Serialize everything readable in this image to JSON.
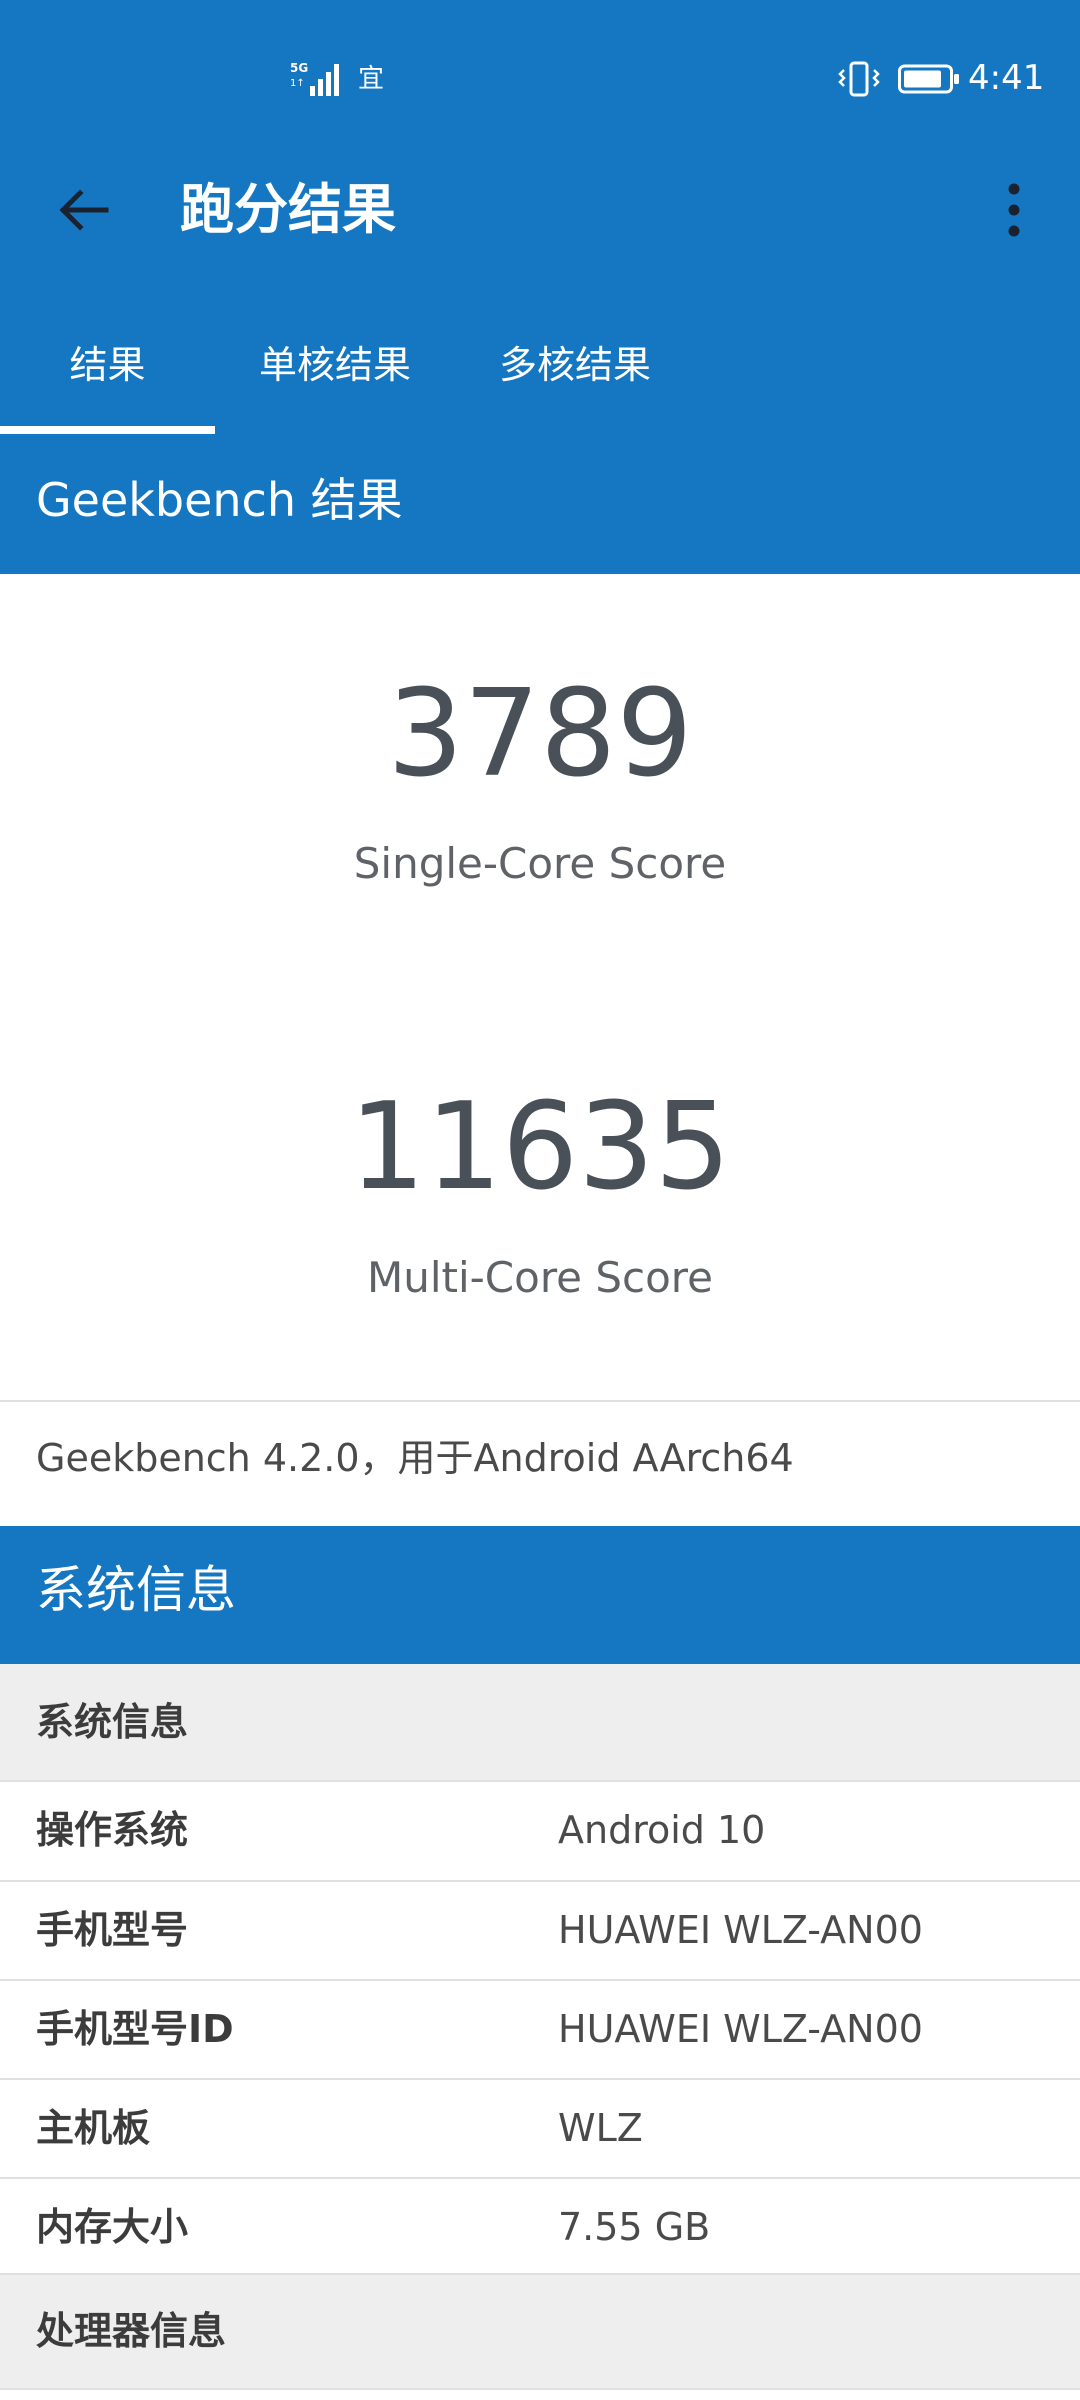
{
  "status_bar": {
    "network_tag": "5G",
    "network_sub": "1↑",
    "extra_icon_text": "宜",
    "time": "4:41"
  },
  "app_bar": {
    "title": "跑分结果",
    "back_icon": "arrow-left-icon",
    "menu_icon": "more-vert-icon"
  },
  "tabs": [
    {
      "label": "结果",
      "selected": true
    },
    {
      "label": "单核结果",
      "selected": false
    },
    {
      "label": "多核结果",
      "selected": false
    }
  ],
  "results": {
    "header": "Geekbench 结果",
    "single_core_score": "3789",
    "single_core_label": "Single-Core Score",
    "multi_core_score": "11635",
    "multi_core_label": "Multi-Core Score",
    "version_text": "Geekbench 4.2.0，用于Android AArch64"
  },
  "system_info": {
    "header": "系统信息",
    "group_label": "系统信息",
    "rows": [
      {
        "label": "操作系统",
        "value": "Android 10"
      },
      {
        "label": "手机型号",
        "value": "HUAWEI WLZ-AN00"
      },
      {
        "label": "手机型号ID",
        "value": "HUAWEI WLZ-AN00"
      },
      {
        "label": "主机板",
        "value": "WLZ"
      },
      {
        "label": "内存大小",
        "value": "7.55 GB"
      }
    ],
    "next_group_label": "处理器信息"
  },
  "colors": {
    "primary": "#1577c2",
    "score_text": "#4a5058",
    "group_bg": "#eeeeee"
  }
}
